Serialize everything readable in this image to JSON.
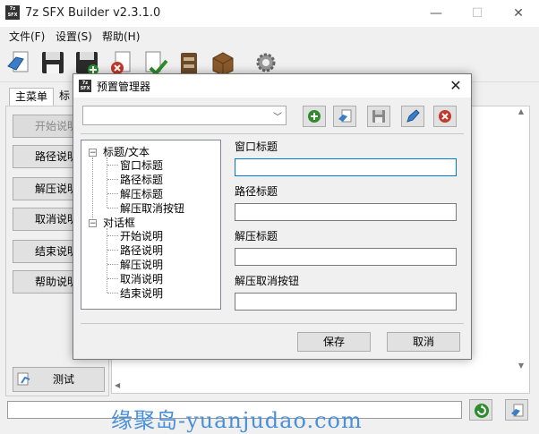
{
  "app": {
    "title": "7z SFX Builder v2.3.1.0",
    "icon_text": "7z\nSFX",
    "window_controls": {
      "minimize": "—",
      "maximize": "☐",
      "close": "✕"
    }
  },
  "menu": {
    "items": [
      "文件(F)",
      "设置(S)",
      "帮助(H)"
    ]
  },
  "toolbar": {
    "icons": [
      "open-icon",
      "save-icon",
      "save-as-icon",
      "delete-icon",
      "check-icon",
      "archive-icon",
      "package-icon",
      "settings-icon"
    ]
  },
  "tabs": {
    "main": "主菜单",
    "title": "标"
  },
  "sidebar": {
    "buttons": [
      "开始说明",
      "路径说明",
      "解压说明",
      "取消说明",
      "结束说明",
      "帮助说明"
    ],
    "test": "测试"
  },
  "dialog": {
    "title": "预置管理器",
    "close": "✕",
    "preset_selected": "",
    "tree": {
      "groups": [
        {
          "label": "标题/文本",
          "expander": "−",
          "children": [
            "窗口标题",
            "路径标题",
            "解压标题",
            "解压取消按钮"
          ]
        },
        {
          "label": "对话框",
          "expander": "−",
          "children": [
            "开始说明",
            "路径说明",
            "解压说明",
            "取消说明",
            "结束说明"
          ]
        }
      ]
    },
    "fields": [
      {
        "label": "窗口标题",
        "value": ""
      },
      {
        "label": "路径标题",
        "value": ""
      },
      {
        "label": "解压标题",
        "value": ""
      },
      {
        "label": "解压取消按钮",
        "value": ""
      }
    ],
    "save": "保存",
    "cancel": "取消"
  },
  "watermark": "缘聚岛-yuanjudao.com",
  "colors": {
    "accent": "#0078d7",
    "watermark": "#4a90d9",
    "add_green": "#2e8b2e",
    "delete_red": "#c0392b"
  }
}
